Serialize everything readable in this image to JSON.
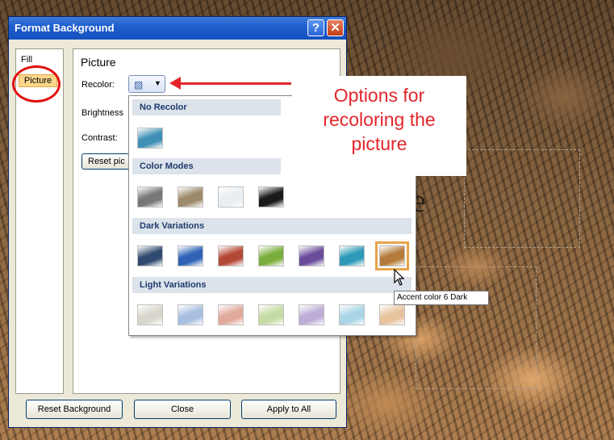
{
  "dialog": {
    "title": "Format Background",
    "help_glyph": "?",
    "close_glyph": "✕"
  },
  "nav": {
    "items": [
      {
        "label": "Fill",
        "selected": false
      },
      {
        "label": "Picture",
        "selected": true
      }
    ]
  },
  "panel": {
    "section_title": "Picture",
    "recolor_label": "Recolor:",
    "brightness_label": "Brightness",
    "contrast_label": "Contrast:",
    "reset_picture_label": "Reset pic"
  },
  "recolor_menu": {
    "no_recolor_header": "No Recolor",
    "color_modes_header": "Color Modes",
    "dark_variations_header": "Dark Variations",
    "light_variations_header": "Light Variations",
    "no_recolor_swatches": [
      "#3f8fb4"
    ],
    "color_mode_swatches": [
      "#777777",
      "#9c8a6a",
      "#e8eef2",
      "#1a1a1a"
    ],
    "dark_variation_swatches": [
      "#2f4a6e",
      "#2d62b4",
      "#b44836",
      "#7aae3c",
      "#6a4c9a",
      "#2c9ab8",
      "#b47a3a"
    ],
    "light_variation_swatches": [
      "#d8d6cc",
      "#a7bfdf",
      "#e1a99c",
      "#c6dba4",
      "#bcaed6",
      "#a9d5e6",
      "#e6c39d"
    ],
    "selected_swatch": "Accent color 6 Dark",
    "tooltip": "Accent color 6 Dark"
  },
  "footer": {
    "reset_background": "Reset Background",
    "close": "Close",
    "apply_to_all": "Apply to All"
  },
  "annotation": {
    "text_lines": [
      "Options for",
      "recoloring the",
      "picture"
    ],
    "color": "#e3252b"
  },
  "background_text": "e",
  "colors": {
    "title_bar": "#1f5fcd",
    "dialog_face": "#ece9d8",
    "highlight_oval": "#e01010",
    "selected_outline": "#e8a34a"
  }
}
